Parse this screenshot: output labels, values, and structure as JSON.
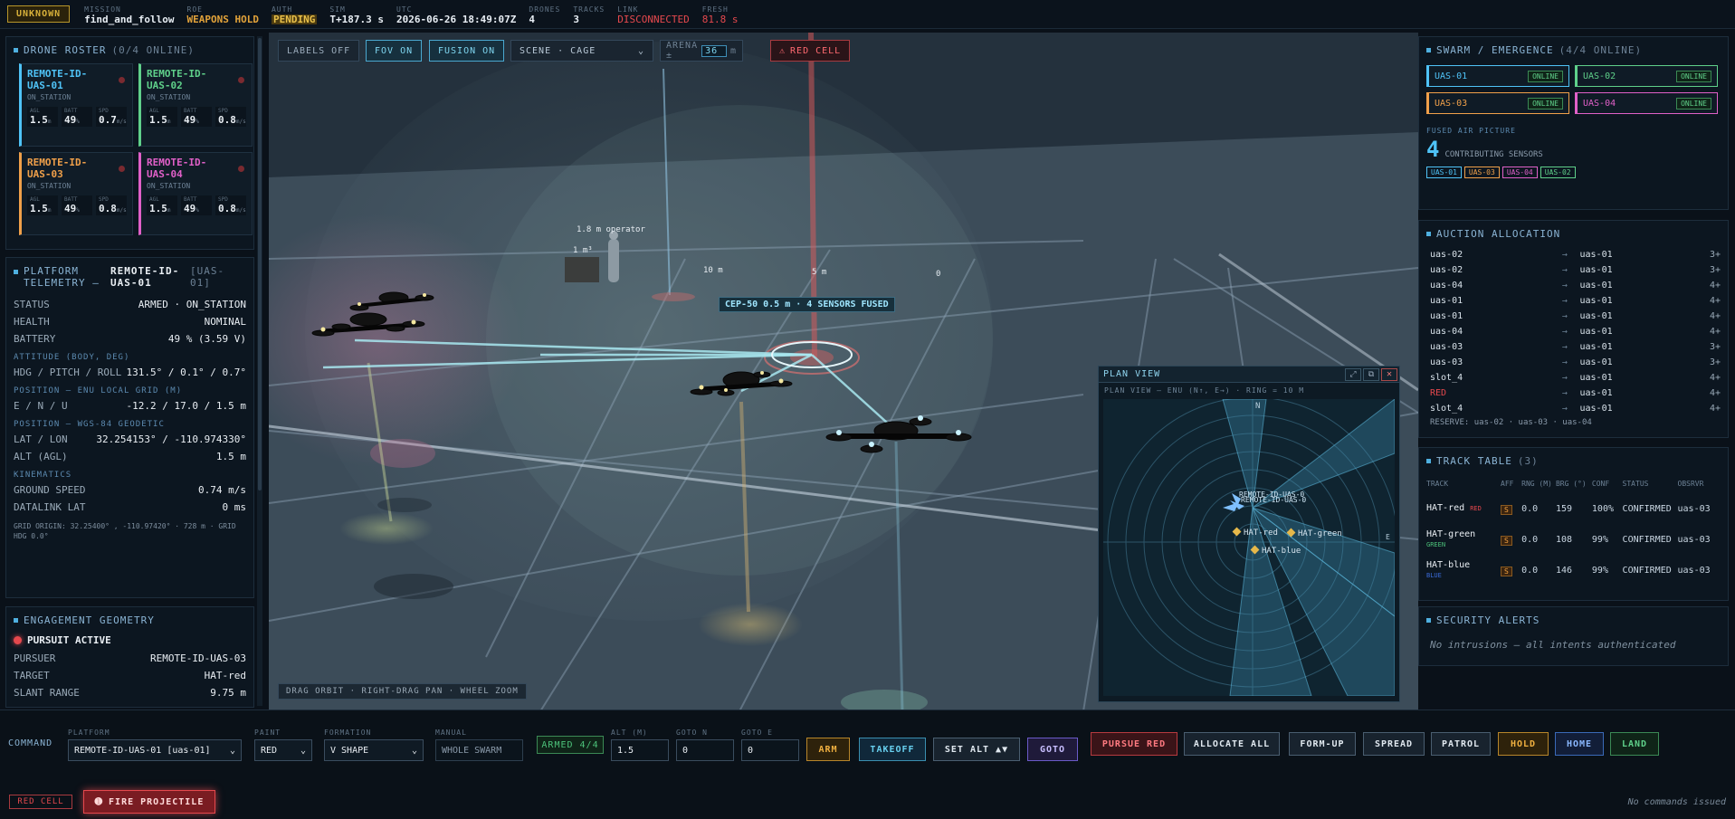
{
  "topbar": {
    "status_badge": "UNKNOWN",
    "mission_k": "MISSION",
    "mission_v": "find_and_follow",
    "roe_k": "ROE",
    "roe_v": "WEAPONS HOLD",
    "auth_k": "AUTH",
    "auth_v": "PENDING",
    "sim_k": "SIM",
    "sim_v": "T+187.3 s",
    "utc_k": "UTC",
    "utc_v": "2026-06-26 18:49:07Z",
    "drones_k": "DRONES",
    "drones_v": "4",
    "tracks_k": "TRACKS",
    "tracks_v": "3",
    "link_k": "LINK",
    "link_v": "DISCONNECTED",
    "fresh_k": "FRESH",
    "fresh_v": "81.8 s"
  },
  "roster": {
    "title": "DRONE ROSTER",
    "count": "(0/4 ONLINE)",
    "drones": [
      {
        "name": "REMOTE-ID-UAS-01",
        "state": "ON_STATION",
        "agl_k": "AGL",
        "agl": "1.5",
        "agl_u": "m",
        "batt_k": "BATT",
        "batt": "49",
        "batt_u": "%",
        "spd_k": "SPD",
        "spd": "0.7",
        "spd_u": "m/s",
        "color": "#4fc3f7"
      },
      {
        "name": "REMOTE-ID-UAS-02",
        "state": "ON_STATION",
        "agl_k": "AGL",
        "agl": "1.5",
        "agl_u": "m",
        "batt_k": "BATT",
        "batt": "49",
        "batt_u": "%",
        "spd_k": "SPD",
        "spd": "0.8",
        "spd_u": "m/s",
        "color": "#5fd08a"
      },
      {
        "name": "REMOTE-ID-UAS-03",
        "state": "ON_STATION",
        "agl_k": "AGL",
        "agl": "1.5",
        "agl_u": "m",
        "batt_k": "BATT",
        "batt": "49",
        "batt_u": "%",
        "spd_k": "SPD",
        "spd": "0.8",
        "spd_u": "m/s",
        "color": "#f0a04a"
      },
      {
        "name": "REMOTE-ID-UAS-04",
        "state": "ON_STATION",
        "agl_k": "AGL",
        "agl": "1.5",
        "agl_u": "m",
        "batt_k": "BATT",
        "batt": "49",
        "batt_u": "%",
        "spd_k": "SPD",
        "spd": "0.8",
        "spd_u": "m/s",
        "color": "#e060c8"
      }
    ]
  },
  "telemetry": {
    "title": "PLATFORM TELEMETRY —",
    "platform": "REMOTE-ID-UAS-01",
    "platform_id": "[UAS-01]",
    "rows": [
      {
        "k": "STATUS",
        "v": "ARMED · ON_STATION"
      },
      {
        "k": "HEALTH",
        "v": "NOMINAL"
      },
      {
        "k": "BATTERY",
        "v": "49 % (3.59 V)"
      }
    ],
    "att_title": "ATTITUDE (BODY, DEG)",
    "att_k": "HDG / PITCH / ROLL",
    "att_v": "131.5° / 0.1° / 0.7°",
    "enu_title": "POSITION — ENU LOCAL GRID (M)",
    "enu_k": "E / N / U",
    "enu_v": "-12.2 / 17.0 / 1.5 m",
    "wgs_title": "POSITION — WGS-84 GEODETIC",
    "latlon_k": "LAT / LON",
    "latlon_v": "32.254153° / -110.974330°",
    "alt_k": "ALT (AGL)",
    "alt_v": "1.5 m",
    "kin_title": "KINEMATICS",
    "gs_k": "GROUND SPEED",
    "gs_v": "0.74 m/s",
    "dl_k": "DATALINK LAT",
    "dl_v": "0 ms",
    "origin": "GRID ORIGIN: 32.25400° , -110.97420° · 728 m · GRID HDG 0.0°"
  },
  "engagement": {
    "title": "ENGAGEMENT GEOMETRY",
    "status": "PURSUIT ACTIVE",
    "pursuer_k": "PURSUER",
    "pursuer_v": "REMOTE-ID-UAS-03",
    "target_k": "TARGET",
    "target_v": "HAT-red",
    "slant_k": "SLANT RANGE",
    "slant_v": "9.75 m"
  },
  "viewport": {
    "labels_btn": "LABELS OFF",
    "fov_btn": "FOV ON",
    "fusion_btn": "FUSION ON",
    "scene_select": "SCENE · CAGE",
    "arena_label": "ARENA ±",
    "arena_value": "36",
    "arena_unit": "m",
    "redcell_btn": "RED CELL",
    "operator_label": "1.8 m operator",
    "box_label": "1 m³",
    "ring10": "10 m",
    "ring5": "5 m",
    "ring0": "0",
    "cep_label": "CEP-50 0.5 m · 4 SENSORS FUSED",
    "hint": "DRAG ORBIT · RIGHT-DRAG PAN · WHEEL ZOOM"
  },
  "planview": {
    "title": "PLAN VIEW",
    "subtitle": "PLAN VIEW — ENU (N↑, E→) · RING = 10 M",
    "north": "N",
    "east": "E",
    "cluster_a": "REMOTE-ID-UAS-0",
    "cluster_b": "REMOTE-ID-UAS-0",
    "hat_red": "HAT-red",
    "hat_green": "HAT-green",
    "hat_blue": "HAT-blue"
  },
  "swarm": {
    "title": "SWARM / EMERGENCE",
    "count": "(4/4 ONLINE)",
    "units": [
      {
        "name": "UAS-01",
        "status": "ONLINE",
        "color": "#4fc3f7"
      },
      {
        "name": "UAS-02",
        "status": "ONLINE",
        "color": "#5fd08a"
      },
      {
        "name": "UAS-03",
        "status": "ONLINE",
        "color": "#f0a04a"
      },
      {
        "name": "UAS-04",
        "status": "ONLINE",
        "color": "#e060c8"
      }
    ],
    "fused_title": "FUSED AIR PICTURE",
    "fused_count": "4",
    "fused_label": "CONTRIBUTING SENSORS",
    "sensors": [
      {
        "name": "UAS-01",
        "color": "#4fc3f7"
      },
      {
        "name": "UAS-03",
        "color": "#f0a04a"
      },
      {
        "name": "UAS-04",
        "color": "#e060c8"
      },
      {
        "name": "UAS-02",
        "color": "#5fd08a"
      }
    ]
  },
  "auction": {
    "title": "AUCTION ALLOCATION",
    "rows": [
      {
        "a": "uas-02",
        "b": "uas-01",
        "n": "3+"
      },
      {
        "a": "uas-02",
        "b": "uas-01",
        "n": "3+"
      },
      {
        "a": "uas-04",
        "b": "uas-01",
        "n": "4+"
      },
      {
        "a": "uas-01",
        "b": "uas-01",
        "n": "4+"
      },
      {
        "a": "uas-01",
        "b": "uas-01",
        "n": "4+"
      },
      {
        "a": "uas-04",
        "b": "uas-01",
        "n": "4+"
      },
      {
        "a": "uas-03",
        "b": "uas-01",
        "n": "3+"
      },
      {
        "a": "uas-03",
        "b": "uas-01",
        "n": "3+"
      },
      {
        "a": "slot_4",
        "b": "uas-01",
        "n": "4+"
      },
      {
        "a": "RED",
        "b": "uas-01",
        "n": "4+"
      },
      {
        "a": "slot_4",
        "b": "uas-01",
        "n": "4+"
      }
    ],
    "arrow": "→",
    "reserve": "RESERVE: uas-02 · uas-03 · uas-04"
  },
  "tracks": {
    "title": "TRACK TABLE",
    "count": "(3)",
    "headers": [
      "TRACK",
      "AFF",
      "RNG (M)",
      "BRG (°)",
      "CONF",
      "STATUS",
      "OBSRVR"
    ],
    "rows": [
      {
        "track": "HAT-red",
        "tag": "RED",
        "aff": "S",
        "rng": "0.0",
        "brg": "159",
        "conf": "100%",
        "status": "CONFIRMED",
        "obs": "uas-03"
      },
      {
        "track": "HAT-green",
        "tag": "GREEN",
        "aff": "S",
        "rng": "0.0",
        "brg": "108",
        "conf": "99%",
        "status": "CONFIRMED",
        "obs": "uas-03"
      },
      {
        "track": "HAT-blue",
        "tag": "BLUE",
        "aff": "S",
        "rng": "0.0",
        "brg": "146",
        "conf": "99%",
        "status": "CONFIRMED",
        "obs": "uas-03"
      }
    ]
  },
  "security": {
    "title": "SECURITY ALERTS",
    "message": "No intrusions — all intents authenticated"
  },
  "command": {
    "label": "COMMAND",
    "platform_k": "PLATFORM",
    "platform_v": "REMOTE-ID-UAS-01 [uas-01]",
    "paint_k": "PAINT",
    "paint_v": "RED",
    "formation_k": "FORMATION",
    "formation_v": "V SHAPE",
    "manual_k": "MANUAL",
    "manual_v": "WHOLE SWARM",
    "armed": "ARMED 4/4",
    "alt_k": "ALT (M)",
    "alt_v": "1.5",
    "gn_k": "GOTO N",
    "gn_v": "0",
    "ge_k": "GOTO E",
    "ge_v": "0",
    "arm": "ARM",
    "takeoff": "TAKEOFF",
    "setalt": "SET ALT ▲▼",
    "goto": "GOTO",
    "pursue": "PURSUE RED",
    "allocate": "ALLOCATE ALL",
    "formup": "FORM-UP",
    "spread": "SPREAD",
    "patrol": "PATROL",
    "hold": "HOLD",
    "home": "HOME",
    "land": "LAND",
    "redcell": "RED CELL",
    "fire": "FIRE PROJECTILE",
    "log": "No commands issued"
  }
}
